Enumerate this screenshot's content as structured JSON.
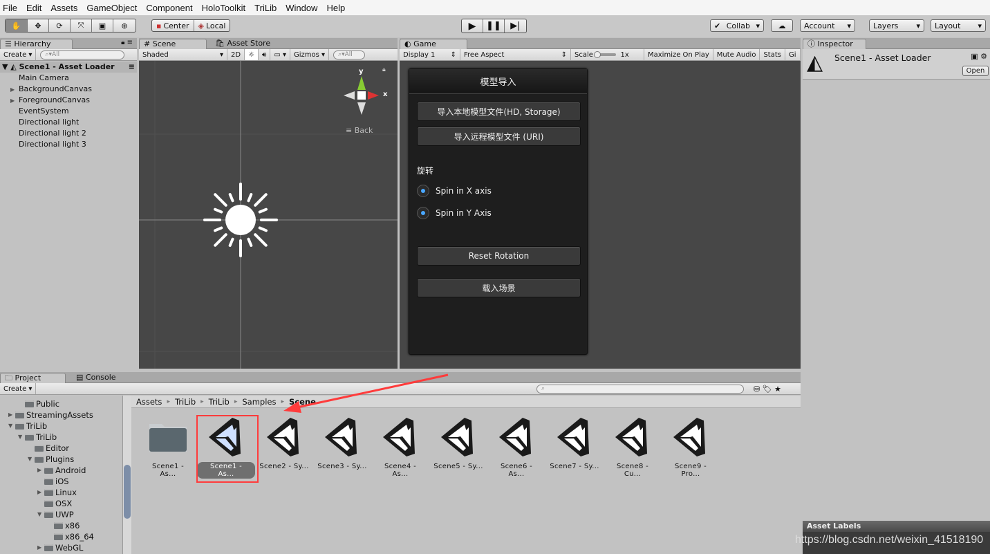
{
  "menu": [
    "File",
    "Edit",
    "Assets",
    "GameObject",
    "Component",
    "HoloToolkit",
    "TriLib",
    "Window",
    "Help"
  ],
  "toolbar": {
    "tools": [
      "hand-icon",
      "move-icon",
      "rotate-icon",
      "scale-icon",
      "rect-icon",
      "transform-icon"
    ],
    "pivot": "Center",
    "space": "Local",
    "collab": "Collab",
    "account": "Account",
    "layers": "Layers",
    "layout": "Layout"
  },
  "hierarchy": {
    "tab": "Hierarchy",
    "create": "Create",
    "search": "All",
    "scene": "Scene1 - Asset Loader",
    "items": [
      "Main Camera",
      "BackgroundCanvas",
      "ForegroundCanvas",
      "EventSystem",
      "Directional light",
      "Directional light 2",
      "Directional light 3"
    ],
    "expandable": [
      false,
      true,
      true,
      false,
      false,
      false,
      false
    ]
  },
  "scene": {
    "tabs": [
      "Scene",
      "Asset Store"
    ],
    "shading": "Shaded",
    "mode2d": "2D",
    "gizmos": "Gizmos",
    "search": "All",
    "gizmo_back": "Back",
    "axis_y": "y",
    "axis_x": "x"
  },
  "game": {
    "tab": "Game",
    "display": "Display 1",
    "aspect": "Free Aspect",
    "scale_label": "Scale",
    "scale_value": "1x",
    "maximize": "Maximize On Play",
    "mute": "Mute Audio",
    "stats": "Stats",
    "gizmos_short": "Gi",
    "panel": {
      "title": "模型导入",
      "btn_local": "导入本地模型文件(HD, Storage)",
      "btn_remote": "导入远程模型文件 (URI)",
      "rotate_label": "旋转",
      "spin_x": "Spin in X axis",
      "spin_y": "Spin in Y Axis",
      "reset": "Reset Rotation",
      "load_scene": "载入场景"
    }
  },
  "inspector": {
    "tab": "Inspector",
    "title": "Scene1 - Asset Loader",
    "open": "Open",
    "asset_labels": "Asset Labels"
  },
  "project": {
    "tabs": [
      "Project",
      "Console"
    ],
    "create": "Create",
    "tree": [
      {
        "label": "Public",
        "depth": 2,
        "arrow": ""
      },
      {
        "label": "StreamingAssets",
        "depth": 1,
        "arrow": "▶"
      },
      {
        "label": "TriLib",
        "depth": 1,
        "arrow": "▼"
      },
      {
        "label": "TriLib",
        "depth": 2,
        "arrow": "▼"
      },
      {
        "label": "Editor",
        "depth": 3,
        "arrow": ""
      },
      {
        "label": "Plugins",
        "depth": 3,
        "arrow": "▼"
      },
      {
        "label": "Android",
        "depth": 4,
        "arrow": "▶"
      },
      {
        "label": "iOS",
        "depth": 4,
        "arrow": ""
      },
      {
        "label": "Linux",
        "depth": 4,
        "arrow": "▶"
      },
      {
        "label": "OSX",
        "depth": 4,
        "arrow": ""
      },
      {
        "label": "UWP",
        "depth": 4,
        "arrow": "▼"
      },
      {
        "label": "x86",
        "depth": 5,
        "arrow": ""
      },
      {
        "label": "x86_64",
        "depth": 5,
        "arrow": ""
      },
      {
        "label": "WebGL",
        "depth": 4,
        "arrow": "▶"
      }
    ],
    "breadcrumb": [
      "Assets",
      "TriLib",
      "TriLib",
      "Samples",
      "Scene"
    ],
    "assets": [
      {
        "label": "Scene1 - As...",
        "type": "folder"
      },
      {
        "label": "Scene1 - As...",
        "type": "scene",
        "selected": true
      },
      {
        "label": "Scene2 - Sy...",
        "type": "scene"
      },
      {
        "label": "Scene3 - Sy...",
        "type": "scene"
      },
      {
        "label": "Scene4 - As...",
        "type": "scene"
      },
      {
        "label": "Scene5 - Sy...",
        "type": "scene"
      },
      {
        "label": "Scene6 - As...",
        "type": "scene"
      },
      {
        "label": "Scene7 - Sy...",
        "type": "scene"
      },
      {
        "label": "Scene8 - Cu...",
        "type": "scene"
      },
      {
        "label": "Scene9 - Pro...",
        "type": "scene"
      }
    ]
  },
  "watermark": "https://blog.csdn.net/weixin_41518190",
  "colors": {
    "highlight": "#ff3b3b",
    "radio": "#4aa8ff",
    "scene_bg": "#474747",
    "game_panel": "#1e1e1e"
  }
}
